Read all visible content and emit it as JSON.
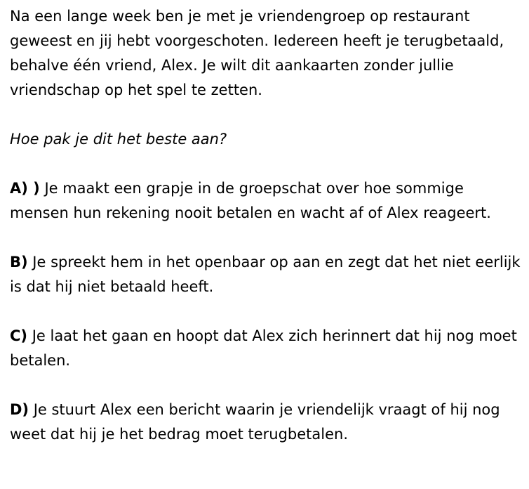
{
  "scenario": "Na een lange week ben je met je vriendengroep op restaurant geweest en jij hebt voorgeschoten. Iedereen heeft je terugbetaald, behalve één vriend, Alex. Je wilt dit aankaarten zonder jullie vriendschap op het spel te zetten.",
  "question": "Hoe pak je dit het beste aan?",
  "options": [
    {
      "letter": "A) )",
      "text": " Je maakt een grapje in de groepschat over hoe sommige mensen hun rekening nooit betalen en wacht af of Alex reageert."
    },
    {
      "letter": "B)",
      "text": " Je spreekt hem in het openbaar op aan en zegt dat het niet eerlijk is dat hij niet betaald heeft."
    },
    {
      "letter": "C)",
      "text": " Je laat het gaan en hoopt dat Alex zich herinnert dat hij nog moet betalen."
    },
    {
      "letter": "D)",
      "text": " Je stuurt Alex een bericht waarin je vriendelijk vraagt of hij nog weet dat hij je het bedrag moet terugbetalen."
    }
  ]
}
